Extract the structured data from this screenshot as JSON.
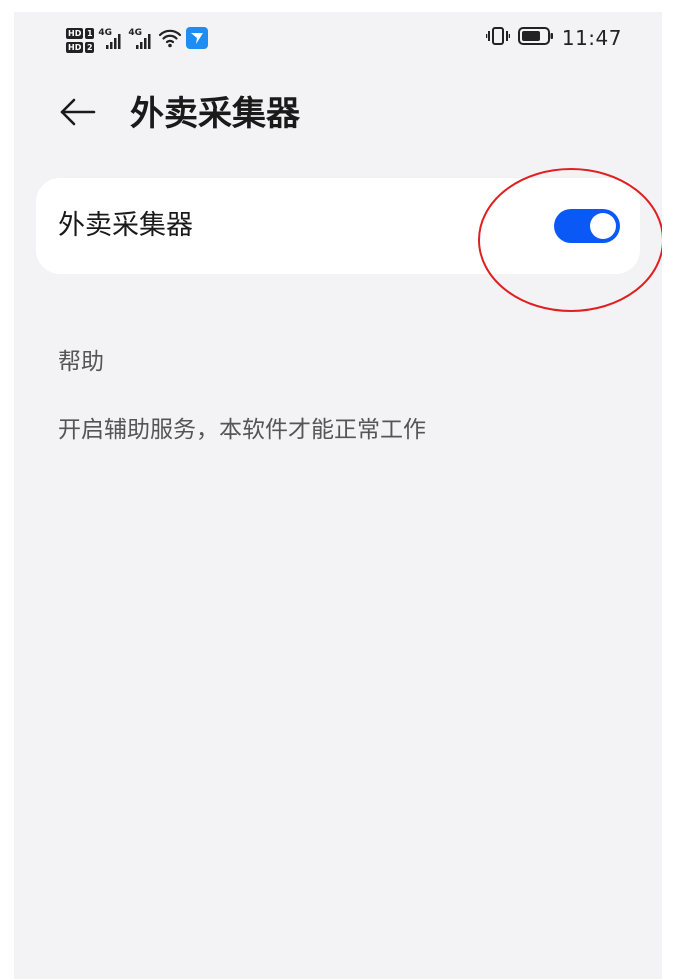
{
  "status_bar": {
    "hd_label": "HD",
    "sim1": "1",
    "sim2": "2",
    "network1": "4G",
    "network2": "4G",
    "time": "11:47"
  },
  "header": {
    "title": "外卖采集器"
  },
  "setting": {
    "label": "外卖采集器",
    "enabled": true
  },
  "help": {
    "title": "帮助",
    "text": "开启辅助服务，本软件才能正常工作"
  },
  "colors": {
    "toggle_on": "#0a59f7",
    "annotation": "#e02020",
    "background": "#f3f3f5"
  },
  "icons": {
    "back": "arrow-left-icon",
    "wifi": "wifi-icon",
    "vibrate": "vibrate-icon",
    "battery": "battery-icon",
    "app_notification": "notification-app-icon"
  }
}
